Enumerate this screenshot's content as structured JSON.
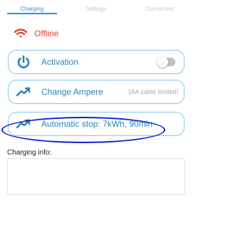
{
  "tabs": [
    {
      "label": "Charging",
      "active": true
    },
    {
      "label": "Settings",
      "active": false
    },
    {
      "label": "Connection",
      "active": false
    }
  ],
  "status": {
    "text": "Offline",
    "icon": "wifi-icon",
    "color": "#e2452d"
  },
  "cards": {
    "activation": {
      "label": "Activation",
      "icon": "power-icon",
      "toggle_on": false
    },
    "change_ampere": {
      "label": "Change Ampere",
      "note": "16A cable limited!",
      "icon": "trend-up-icon"
    },
    "automatic_stop": {
      "label": "Automatic stop: 7kWh, 90min",
      "icon": "trend-up-icon"
    }
  },
  "charging_info": {
    "heading": "Charging info:"
  },
  "colors": {
    "accent": "#2b82b4",
    "card_border": "#86c9e2",
    "offline": "#e2452d",
    "annotation": "#0f22d4"
  }
}
